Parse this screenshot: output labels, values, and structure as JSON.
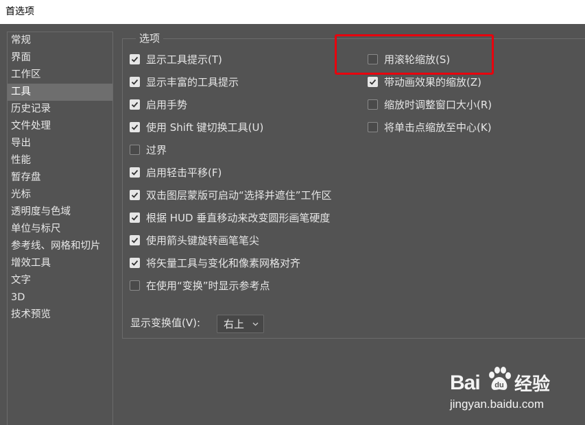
{
  "window": {
    "title": "首选项"
  },
  "sidebar": {
    "items": [
      {
        "label": "常规"
      },
      {
        "label": "界面"
      },
      {
        "label": "工作区"
      },
      {
        "label": "工具",
        "active": true
      },
      {
        "label": "历史记录"
      },
      {
        "label": "文件处理"
      },
      {
        "label": "导出"
      },
      {
        "label": "性能"
      },
      {
        "label": "暂存盘"
      },
      {
        "label": "光标"
      },
      {
        "label": "透明度与色域"
      },
      {
        "label": "单位与标尺"
      },
      {
        "label": "参考线、网格和切片"
      },
      {
        "label": "增效工具"
      },
      {
        "label": "文字"
      },
      {
        "label": "3D"
      },
      {
        "label": "技术预览"
      }
    ]
  },
  "options": {
    "legend": "选项",
    "left": [
      {
        "label": "显示工具提示(T)",
        "checked": true
      },
      {
        "label": "显示丰富的工具提示",
        "checked": true
      },
      {
        "label": "启用手势",
        "checked": true
      },
      {
        "label": "使用 Shift 键切换工具(U)",
        "checked": true
      },
      {
        "label": "过界",
        "checked": false
      },
      {
        "label": "启用轻击平移(F)",
        "checked": true
      },
      {
        "label": "双击图层蒙版可启动“选择并遮住”工作区",
        "checked": true
      },
      {
        "label": "根据 HUD 垂直移动来改变圆形画笔硬度",
        "checked": true
      },
      {
        "label": "使用箭头键旋转画笔笔尖",
        "checked": true
      },
      {
        "label": "将矢量工具与变化和像素网格对齐",
        "checked": true
      },
      {
        "label": "在使用“变换”时显示参考点",
        "checked": false
      }
    ],
    "right": [
      {
        "label": "用滚轮缩放(S)",
        "checked": false
      },
      {
        "label": "带动画效果的缩放(Z)",
        "checked": true
      },
      {
        "label": "缩放时调整窗口大小(R)",
        "checked": false
      },
      {
        "label": "将单击点缩放至中心(K)",
        "checked": false
      }
    ],
    "transform_display": {
      "label": "显示变换值(V):",
      "value": "右上"
    }
  },
  "watermark": {
    "brand_a": "Bai",
    "brand_b": "经验",
    "url": "jingyan.baidu.com"
  },
  "colors": {
    "background": "#535353",
    "highlight": "#e8000d",
    "text": "#e6e6e6"
  }
}
